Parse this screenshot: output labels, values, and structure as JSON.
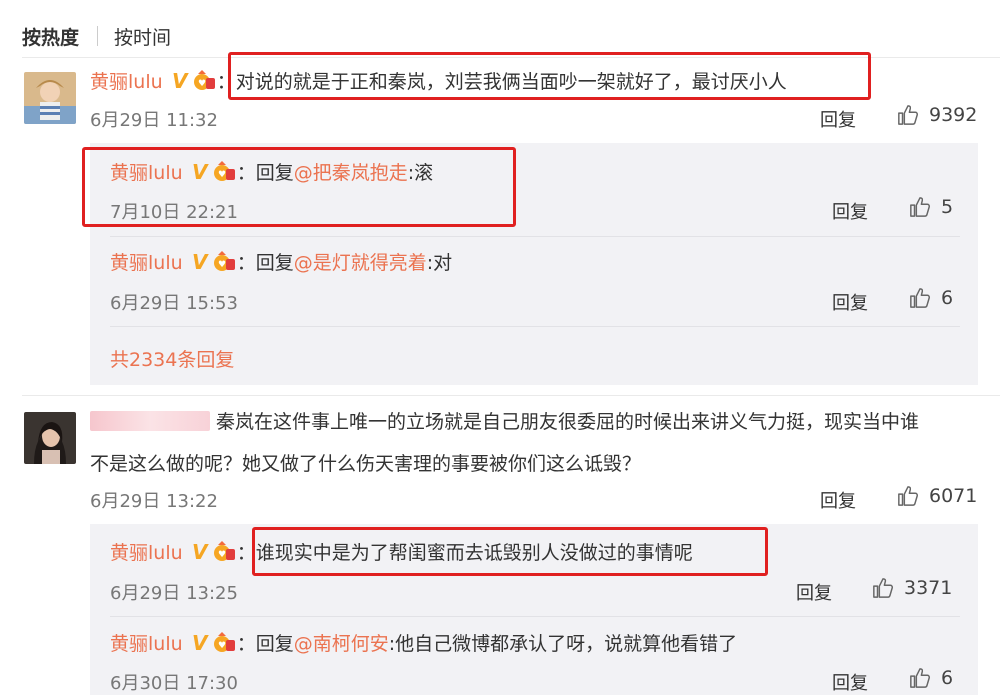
{
  "sort": {
    "hot_label": "按热度",
    "time_label": "按时间"
  },
  "comments": [
    {
      "user": "黄骊lulu",
      "text": "：对说的就是于正和秦岚，刘芸我俩当面吵一架就好了，最讨厌小人",
      "time": "6月29日 11:32",
      "reply_label": "回复",
      "likes": "9392",
      "replies": [
        {
          "user": "黄骊lulu",
          "prefix": "：回复",
          "mention": "@把秦岚抱走",
          "text": ":滚",
          "time": "7月10日 22:21",
          "reply_label": "回复",
          "likes": "5"
        },
        {
          "user": "黄骊lulu",
          "prefix": "：回复",
          "mention": "@是灯就得亮着",
          "text": ":对",
          "time": "6月29日 15:53",
          "reply_label": "回复",
          "likes": "6"
        }
      ],
      "more_replies": "共2334条回复"
    },
    {
      "text_line1": "秦岚在这件事上唯一的立场就是自己朋友很委屈的时候出来讲义气力挺，现实当中谁",
      "text_line2": "不是这么做的呢？她又做了什么伤天害理的事要被你们这么诋毁？",
      "time": "6月29日 13:22",
      "reply_label": "回复",
      "likes": "6071",
      "replies": [
        {
          "user": "黄骊lulu",
          "text": "：谁现实中是为了帮闺蜜而去诋毁别人没做过的事情呢",
          "time": "6月29日 13:25",
          "reply_label": "回复",
          "likes": "3371"
        },
        {
          "user": "黄骊lulu",
          "prefix": "：回复",
          "mention": "@南柯何安",
          "text": ":他自己微博都承认了呀，说就算他看错了",
          "time": "6月30日 17:30",
          "reply_label": "回复",
          "likes": "6"
        }
      ]
    }
  ],
  "colors": {
    "username": "#eb7350",
    "highlight_box": "#e02020",
    "subbox_bg": "#f2f2f5",
    "vip_badge": "#f5a623"
  },
  "icons": {
    "vip": "vip-v-badge-icon",
    "medal": "fan-medal-icon",
    "like": "thumbs-up-icon"
  }
}
